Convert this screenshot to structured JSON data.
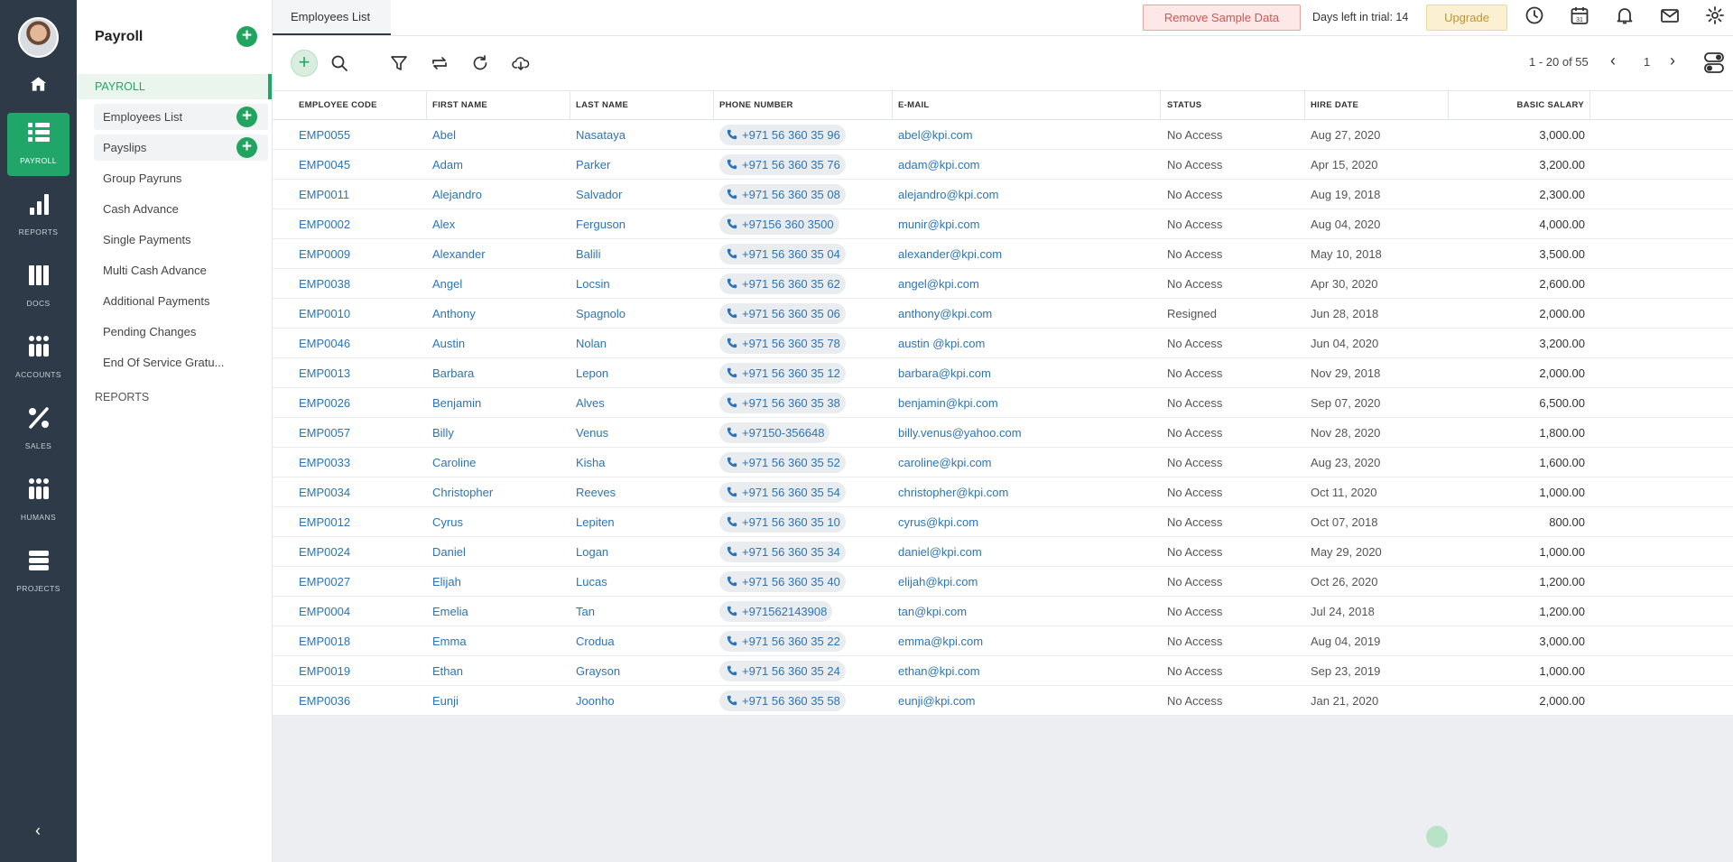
{
  "rail": {
    "items": [
      {
        "label": "PAYROLL",
        "icon": "list-icon",
        "active": true
      },
      {
        "label": "REPORTS",
        "icon": "bar-chart-icon"
      },
      {
        "label": "DOCS",
        "icon": "columns-icon"
      },
      {
        "label": "ACCOUNTS",
        "icon": "grid-icon"
      },
      {
        "label": "SALES",
        "icon": "percent-icon"
      },
      {
        "label": "HUMANS",
        "icon": "grid-icon"
      },
      {
        "label": "PROJECTS",
        "icon": "list-icon"
      }
    ],
    "collapse_label": "‹"
  },
  "sidebar": {
    "title": "Payroll",
    "section": "PAYROLL",
    "items": [
      "Employees List",
      "Payslips",
      "Group Payruns",
      "Cash Advance",
      "Single Payments",
      "Multi Cash Advance",
      "Additional Payments",
      "Pending Changes",
      "End Of Service Gratu..."
    ],
    "reports": "REPORTS"
  },
  "topbar": {
    "tab": "Employees List",
    "remove_sample": "Remove Sample Data",
    "trial": "Days left in trial: 14",
    "upgrade": "Upgrade"
  },
  "toolbar": {
    "pager": "1 - 20 of 55",
    "page": "1"
  },
  "table": {
    "columns": [
      "EMPLOYEE CODE",
      "FIRST NAME",
      "LAST NAME",
      "PHONE NUMBER",
      "E-MAIL",
      "STATUS",
      "HIRE DATE",
      "BASIC SALARY"
    ],
    "rows": [
      [
        "EMP0055",
        "Abel",
        "Nasataya",
        "+971 56 360 35 96",
        "abel@kpi.com",
        "No Access",
        "Aug 27, 2020",
        "3,000.00"
      ],
      [
        "EMP0045",
        "Adam",
        "Parker",
        "+971 56 360 35 76",
        "adam@kpi.com",
        "No Access",
        "Apr 15, 2020",
        "3,200.00"
      ],
      [
        "EMP0011",
        "Alejandro",
        "Salvador",
        "+971 56 360 35 08",
        "alejandro@kpi.com",
        "No Access",
        "Aug 19, 2018",
        "2,300.00"
      ],
      [
        "EMP0002",
        "Alex",
        "Ferguson",
        "+97156 360 3500",
        "munir@kpi.com",
        "No Access",
        "Aug 04, 2020",
        "4,000.00"
      ],
      [
        "EMP0009",
        "Alexander",
        "Balili",
        "+971 56 360 35 04",
        "alexander@kpi.com",
        "No Access",
        "May 10, 2018",
        "3,500.00"
      ],
      [
        "EMP0038",
        "Angel",
        "Locsin",
        "+971 56 360 35 62",
        "angel@kpi.com",
        "No Access",
        "Apr 30, 2020",
        "2,600.00"
      ],
      [
        "EMP0010",
        "Anthony",
        "Spagnolo",
        "+971 56 360 35 06",
        "anthony@kpi.com",
        "Resigned",
        "Jun 28, 2018",
        "2,000.00"
      ],
      [
        "EMP0046",
        "Austin",
        "Nolan",
        "+971 56 360 35 78",
        "austin @kpi.com",
        "No Access",
        "Jun 04, 2020",
        "3,200.00"
      ],
      [
        "EMP0013",
        "Barbara",
        "Lepon",
        "+971 56 360 35 12",
        "barbara@kpi.com",
        "No Access",
        "Nov 29, 2018",
        "2,000.00"
      ],
      [
        "EMP0026",
        "Benjamin",
        "Alves",
        "+971 56 360 35 38",
        "benjamin@kpi.com",
        "No Access",
        "Sep 07, 2020",
        "6,500.00"
      ],
      [
        "EMP0057",
        "Billy",
        "Venus",
        "+97150-356648",
        "billy.venus@yahoo.com",
        "No Access",
        "Nov 28, 2020",
        "1,800.00"
      ],
      [
        "EMP0033",
        "Caroline",
        "Kisha",
        "+971 56 360 35 52",
        "caroline@kpi.com",
        "No Access",
        "Aug 23, 2020",
        "1,600.00"
      ],
      [
        "EMP0034",
        "Christopher",
        "Reeves",
        "+971 56 360 35 54",
        "christopher@kpi.com",
        "No Access",
        "Oct 11, 2020",
        "1,000.00"
      ],
      [
        "EMP0012",
        "Cyrus",
        "Lepiten",
        "+971 56 360 35 10",
        "cyrus@kpi.com",
        "No Access",
        "Oct 07, 2018",
        "800.00"
      ],
      [
        "EMP0024",
        "Daniel",
        "Logan",
        "+971 56 360 35 34",
        "daniel@kpi.com",
        "No Access",
        "May 29, 2020",
        "1,000.00"
      ],
      [
        "EMP0027",
        "Elijah",
        "Lucas",
        "+971 56 360 35 40",
        "elijah@kpi.com",
        "No Access",
        "Oct 26, 2020",
        "1,200.00"
      ],
      [
        "EMP0004",
        "Emelia",
        "Tan",
        "+971562143908",
        "tan@kpi.com",
        "No Access",
        "Jul 24, 2018",
        "1,200.00"
      ],
      [
        "EMP0018",
        "Emma",
        "Crodua",
        "+971 56 360 35 22",
        "emma@kpi.com",
        "No Access",
        "Aug 04, 2019",
        "3,000.00"
      ],
      [
        "EMP0019",
        "Ethan",
        "Grayson",
        "+971 56 360 35 24",
        "ethan@kpi.com",
        "No Access",
        "Sep 23, 2019",
        "1,000.00"
      ],
      [
        "EMP0036",
        "Eunji",
        "Joonho",
        "+971 56 360 35 58",
        "eunji@kpi.com",
        "No Access",
        "Jan 21, 2020",
        "2,000.00"
      ]
    ]
  }
}
